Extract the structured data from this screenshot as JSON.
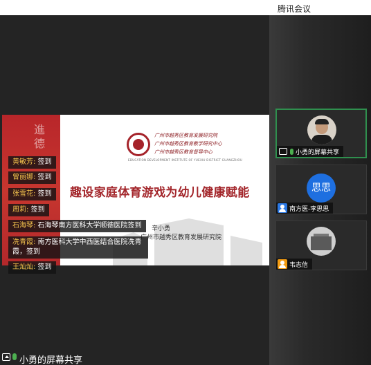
{
  "window": {
    "title": "腾讯会议"
  },
  "slide": {
    "vertical_text": "進德",
    "org_lines": [
      "广州市越秀区教育发展研究院",
      "广州市越秀区教育教学研究中心",
      "广州市越秀区教育督导中心"
    ],
    "org_english": "EDUCATION DEVELOPMENT INSTITUTE OF YUEXIU DISTRICT GUANGZHOU",
    "title": "趣设家庭体育游戏为幼儿健康赋能",
    "author": "辛小勇",
    "institute": "广州市越秀区教育发展研究院"
  },
  "signins": [
    {
      "name": "黄敏芳:",
      "text": " 签到"
    },
    {
      "name": "曾丽娜:",
      "text": " 签到"
    },
    {
      "name": "张雪花:",
      "text": " 签到"
    },
    {
      "name": "周莉:",
      "text": " 签到"
    },
    {
      "name": "石海琴:",
      "text": " 石海琴南方医科大学顺德医院签到"
    },
    {
      "name": "冼青霞:",
      "text": " 南方医科大学中西医结合医院冼青霞，签到"
    },
    {
      "name": "王灿灿:",
      "text": " 签到"
    }
  ],
  "footer": {
    "label": "小勇的屏幕共享"
  },
  "participants": [
    {
      "label": "小勇的屏幕共享",
      "active": true,
      "avatar": "photo",
      "badge": "share-mic"
    },
    {
      "label": "南方医-李思思",
      "active": false,
      "avatar": "text",
      "avatar_text": "思思",
      "badge": "blue"
    },
    {
      "label": "韦志信",
      "active": false,
      "avatar": "building",
      "badge": "orange"
    }
  ],
  "colors": {
    "accent_red": "#a3262b",
    "signin_name": "#f3c24d",
    "active_border": "#2f8f4e",
    "avatar_blue": "#1e6fe0"
  }
}
